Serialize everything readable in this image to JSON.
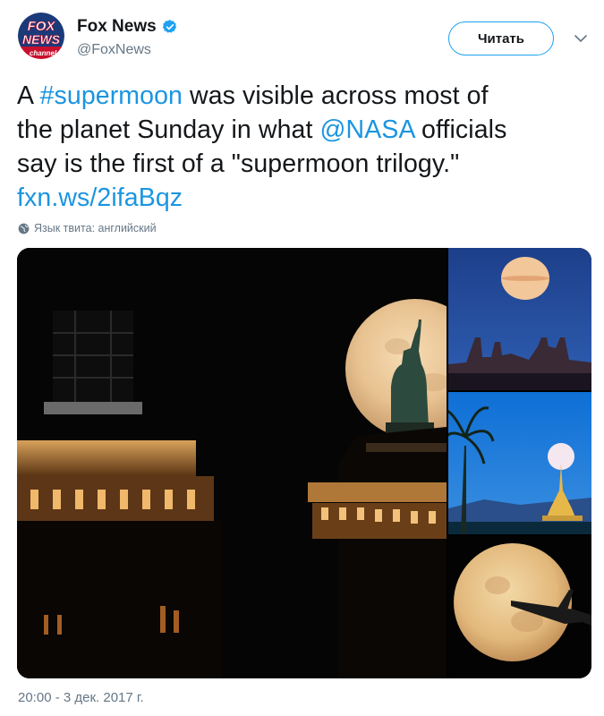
{
  "author": {
    "name": "Fox News",
    "handle": "@FoxNews",
    "avatar_text": [
      "FOX",
      "NEWS",
      "channel"
    ],
    "verified": true
  },
  "follow_button": {
    "label": "Читать"
  },
  "tweet": {
    "lines": [
      [
        {
          "t": "A ",
          "link": false
        },
        {
          "t": "#supermoon",
          "link": true
        },
        {
          "t": " was visible across most of",
          "link": false
        }
      ],
      [
        {
          "t": "the planet Sunday in what ",
          "link": false
        },
        {
          "t": "@NASA",
          "link": true
        },
        {
          "t": " officials",
          "link": false
        }
      ],
      [
        {
          "t": "say is the first of a \"supermoon trilogy.\"",
          "link": false
        }
      ],
      [
        {
          "t": "fxn.ws/2ifaBqz",
          "link": true
        }
      ]
    ]
  },
  "language_note": "Язык твита: английский",
  "timestamp": "20:00 - 3 дек. 2017 г.",
  "colors": {
    "link": "#1b95e0",
    "secondary_text": "#657786",
    "verified": "#1da1f2",
    "fox_red": "#c8102e",
    "fox_blue": "#003366"
  },
  "icons": [
    "verified-badge-icon",
    "chevron-down-icon",
    "globe-icon"
  ]
}
